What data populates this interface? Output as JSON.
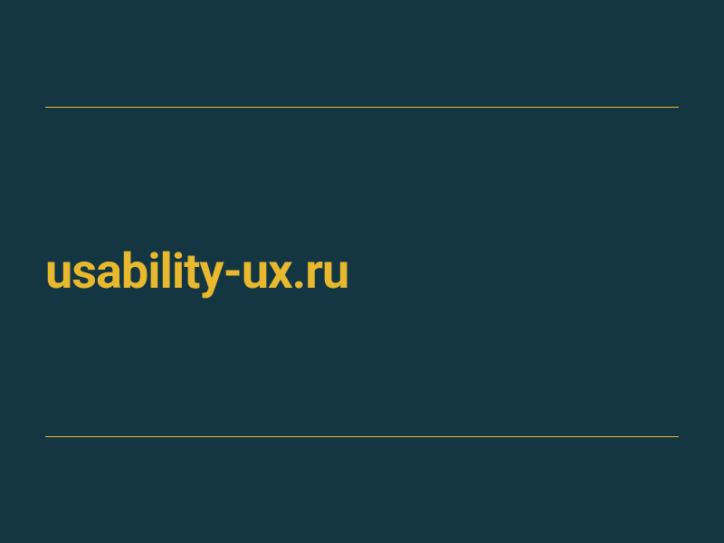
{
  "domain": "usability-ux.ru",
  "colors": {
    "background": "#143642",
    "accent": "#e8b92e"
  }
}
